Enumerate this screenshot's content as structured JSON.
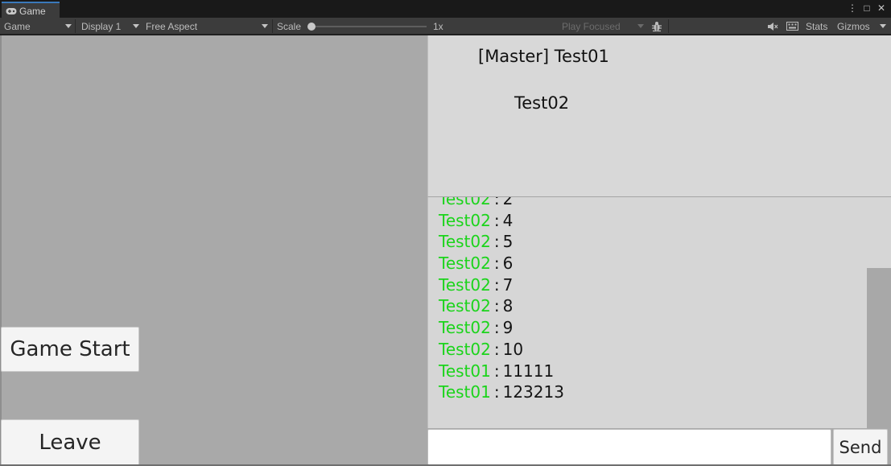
{
  "window": {
    "tab_label": "Game",
    "tab_icon": "gamepad-icon",
    "controls": {
      "more": "⋮",
      "maximize": "□",
      "close": "✕"
    }
  },
  "toolbar": {
    "view_mode": "Game",
    "display": "Display 1",
    "aspect": "Free Aspect",
    "scale_label": "Scale",
    "scale_value": "1x",
    "scale_fraction": 0.0,
    "play_mode": "Play Focused",
    "stats_label": "Stats",
    "gizmos_label": "Gizmos"
  },
  "game": {
    "start_button": "Game Start",
    "leave_button": "Leave",
    "players": [
      {
        "label": "[Master] Test01"
      },
      {
        "label": "Test02"
      }
    ],
    "chat": {
      "separator": ":",
      "messages": [
        {
          "name": "Test02",
          "text": "2"
        },
        {
          "name": "Test02",
          "text": "4"
        },
        {
          "name": "Test02",
          "text": "5"
        },
        {
          "name": "Test02",
          "text": "6"
        },
        {
          "name": "Test02",
          "text": "7"
        },
        {
          "name": "Test02",
          "text": "8"
        },
        {
          "name": "Test02",
          "text": "9"
        },
        {
          "name": "Test02",
          "text": "10"
        },
        {
          "name": "Test01",
          "text": "11111"
        },
        {
          "name": "Test01",
          "text": "123213"
        }
      ]
    },
    "input": {
      "value": "",
      "placeholder": ""
    },
    "send_button": "Send"
  },
  "colors": {
    "chat_name": "#1bd41b",
    "game_background": "#a9a9a9",
    "panel_background": "#d8d8d8",
    "tab_accent": "#3a79bb"
  }
}
